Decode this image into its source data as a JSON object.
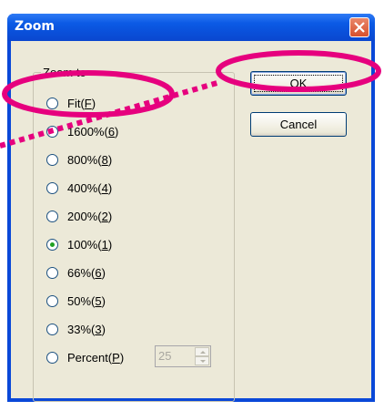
{
  "window": {
    "title": "Zoom",
    "close_icon": "close-icon"
  },
  "group": {
    "label": "Zoom to"
  },
  "options": [
    {
      "label": "Fit(F)",
      "text": "Fit(",
      "key": "F",
      "tail": ")",
      "checked": false
    },
    {
      "label": "1600%(6)",
      "text": "1600%(",
      "key": "6",
      "tail": ")",
      "checked": false
    },
    {
      "label": "800%(8)",
      "text": "800%(",
      "key": "8",
      "tail": ")",
      "checked": false
    },
    {
      "label": "400%(4)",
      "text": "400%(",
      "key": "4",
      "tail": ")",
      "checked": false
    },
    {
      "label": "200%(2)",
      "text": "200%(",
      "key": "2",
      "tail": ")",
      "checked": false
    },
    {
      "label": "100%(1)",
      "text": "100%(",
      "key": "1",
      "tail": ")",
      "checked": true
    },
    {
      "label": "66%(6)",
      "text": "66%(",
      "key": "6",
      "tail": ")",
      "checked": false
    },
    {
      "label": "50%(5)",
      "text": "50%(",
      "key": "5",
      "tail": ")",
      "checked": false
    },
    {
      "label": "33%(3)",
      "text": "33%(",
      "key": "3",
      "tail": ")",
      "checked": false
    },
    {
      "label": "Percent(P)",
      "text": "Percent(",
      "key": "P",
      "tail": ")",
      "checked": false
    }
  ],
  "percent_field": {
    "value": "25"
  },
  "buttons": {
    "ok": "OK",
    "cancel": "Cancel"
  },
  "colors": {
    "annotation": "#e6007e",
    "titlebar": "#0a4fd9",
    "close": "#d6502d"
  }
}
